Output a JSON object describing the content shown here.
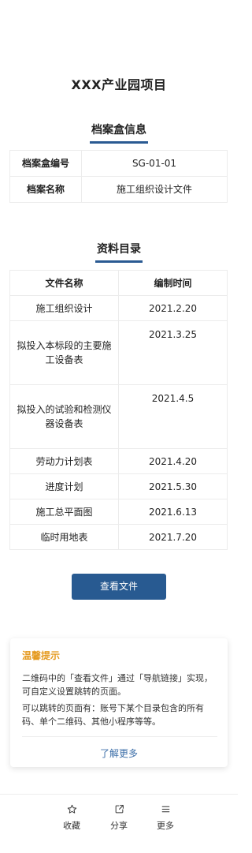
{
  "page": {
    "title": "XXX产业园项目"
  },
  "info_section": {
    "heading": "档案盒信息",
    "rows": [
      {
        "key": "档案盒编号",
        "value": "SG-01-01"
      },
      {
        "key": "档案名称",
        "value": "施工组织设计文件"
      }
    ]
  },
  "catalog_section": {
    "heading": "资料目录",
    "headers": {
      "name": "文件名称",
      "time": "编制时间"
    },
    "rows": [
      {
        "name": "施工组织设计",
        "time": "2021.2.20"
      },
      {
        "name": "拟投入本标段的主要施工设备表",
        "time": "2021.3.25"
      },
      {
        "name": "拟投入的试验和检测仪器设备表",
        "time": "2021.4.5"
      },
      {
        "name": "劳动力计划表",
        "time": "2021.4.20"
      },
      {
        "name": "进度计划",
        "time": "2021.5.30"
      },
      {
        "name": "施工总平面图",
        "time": "2021.6.13"
      },
      {
        "name": "临时用地表",
        "time": "2021.7.20"
      }
    ]
  },
  "view_button": {
    "label": "查看文件",
    "color": "#285a91"
  },
  "tip": {
    "title": "温馨提示",
    "title_color": "#e59a1f",
    "paragraph1": "二维码中的「查看文件」通过「导航链接」实现，可自定义设置跳转的页面。",
    "paragraph2": "可以跳转的页面有：账号下某个目录包含的所有码、单个二维码、其他小程序等等。",
    "more": "了解更多"
  },
  "bottom_nav": {
    "items": [
      {
        "label": "收藏",
        "icon": "star-icon"
      },
      {
        "label": "分享",
        "icon": "share-icon"
      },
      {
        "label": "更多",
        "icon": "menu-icon"
      }
    ]
  }
}
